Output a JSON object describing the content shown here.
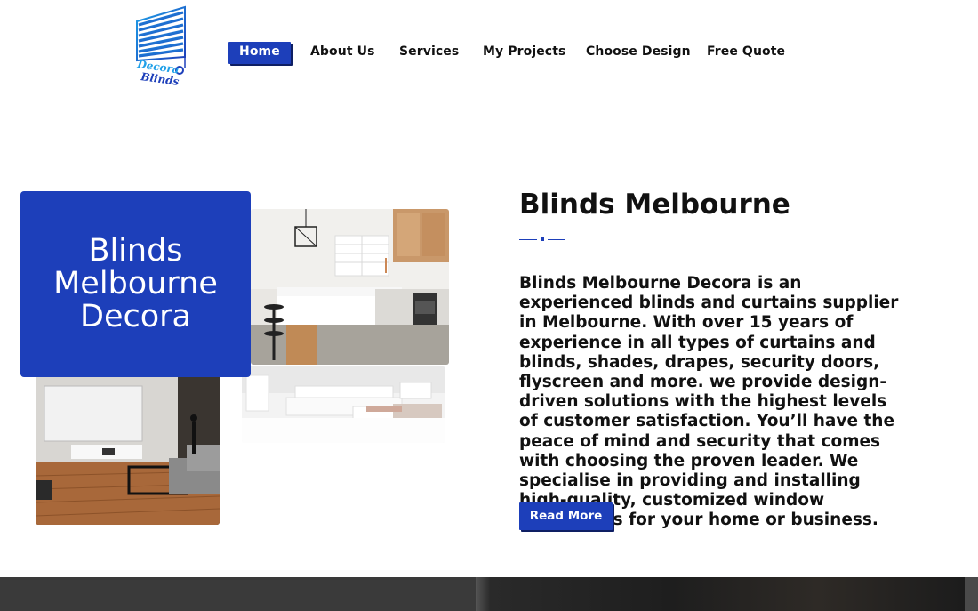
{
  "logo": {
    "line1": "Decora",
    "line2": "Blinds",
    "icon": "blinds-logo-icon"
  },
  "nav": {
    "items": [
      {
        "label": "Home",
        "active": true
      },
      {
        "label": "About Us",
        "active": false
      },
      {
        "label": "Services",
        "active": false
      },
      {
        "label": "My Projects",
        "active": false
      },
      {
        "label": "Choose Design",
        "active": false
      },
      {
        "label": "Free Quote",
        "active": false
      }
    ]
  },
  "hero_card": {
    "text": "Blinds\nMelbourne\nDecora"
  },
  "photos": {
    "kitchen": "kitchen-photo",
    "bedroom": "bedroom-photo",
    "theater": "living-room-photo"
  },
  "main": {
    "heading": "Blinds Melbourne",
    "paragraph": "Blinds Melbourne Decora is an experienced blinds and curtains supplier in Melbourne. With over 15 years of experience in all types of curtains and blinds, shades, drapes, security doors, flyscreen and more. we provide design-driven solutions with the highest levels of customer satisfaction. You’ll have the peace of mind and security that comes with choosing the proven leader. We specialise in providing and installing high-quality, customized window treatments for your home or business.",
    "button_label": "Read More"
  },
  "colors": {
    "accent": "#1d3fba",
    "accent_shadow": "#0e1f63",
    "text": "#111111",
    "footer": "#3a3a3a"
  }
}
